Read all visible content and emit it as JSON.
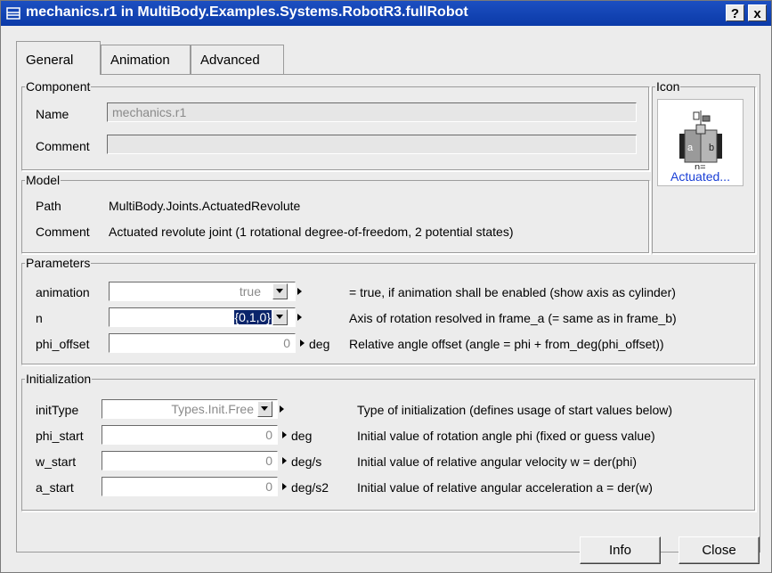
{
  "window": {
    "title": "mechanics.r1 in MultiBody.Examples.Systems.RobotR3.fullRobot",
    "help_label": "?",
    "close_label": "x",
    "titlebar_color": "#0b3aa8"
  },
  "tabs": [
    {
      "label": "General",
      "active": true
    },
    {
      "label": "Animation",
      "active": false
    },
    {
      "label": "Advanced",
      "active": false
    }
  ],
  "component": {
    "group_label": "Component",
    "name_label": "Name",
    "name_value": "mechanics.r1",
    "comment_label": "Comment",
    "comment_value": ""
  },
  "icon": {
    "group_label": "Icon",
    "caption": "Actuated...",
    "glyph_a": "a",
    "glyph_b": "b",
    "glyph_n": "n="
  },
  "model": {
    "group_label": "Model",
    "path_label": "Path",
    "path_value": "MultiBody.Joints.ActuatedRevolute",
    "comment_label": "Comment",
    "comment_value": "Actuated revolute joint (1 rotational degree-of-freedom, 2 potential states)"
  },
  "parameters": {
    "group_label": "Parameters",
    "rows": [
      {
        "name": "animation",
        "value": "true",
        "unit": "",
        "description": "= true, if animation shall be enabled (show axis as cylinder)"
      },
      {
        "name": "n",
        "value": "{0,1,0}",
        "unit": "",
        "description": "Axis of rotation resolved in frame_a (= same as in frame_b)"
      },
      {
        "name": "phi_offset",
        "value": "0",
        "unit": "deg",
        "description": "Relative angle offset (angle = phi + from_deg(phi_offset))"
      }
    ]
  },
  "initialization": {
    "group_label": "Initialization",
    "rows": [
      {
        "name": "initType",
        "value": "Types.Init.Free",
        "unit": "",
        "description": "Type of initialization (defines usage of start values below)"
      },
      {
        "name": "phi_start",
        "value": "0",
        "unit": "deg",
        "description": "Initial value of rotation angle phi (fixed or guess value)"
      },
      {
        "name": "w_start",
        "value": "0",
        "unit": "deg/s",
        "description": "Initial value of relative angular velocity w = der(phi)"
      },
      {
        "name": "a_start",
        "value": "0",
        "unit": "deg/s2",
        "description": "Initial value of relative angular acceleration a = der(w)"
      }
    ]
  },
  "buttons": {
    "info": "Info",
    "close": "Close"
  }
}
